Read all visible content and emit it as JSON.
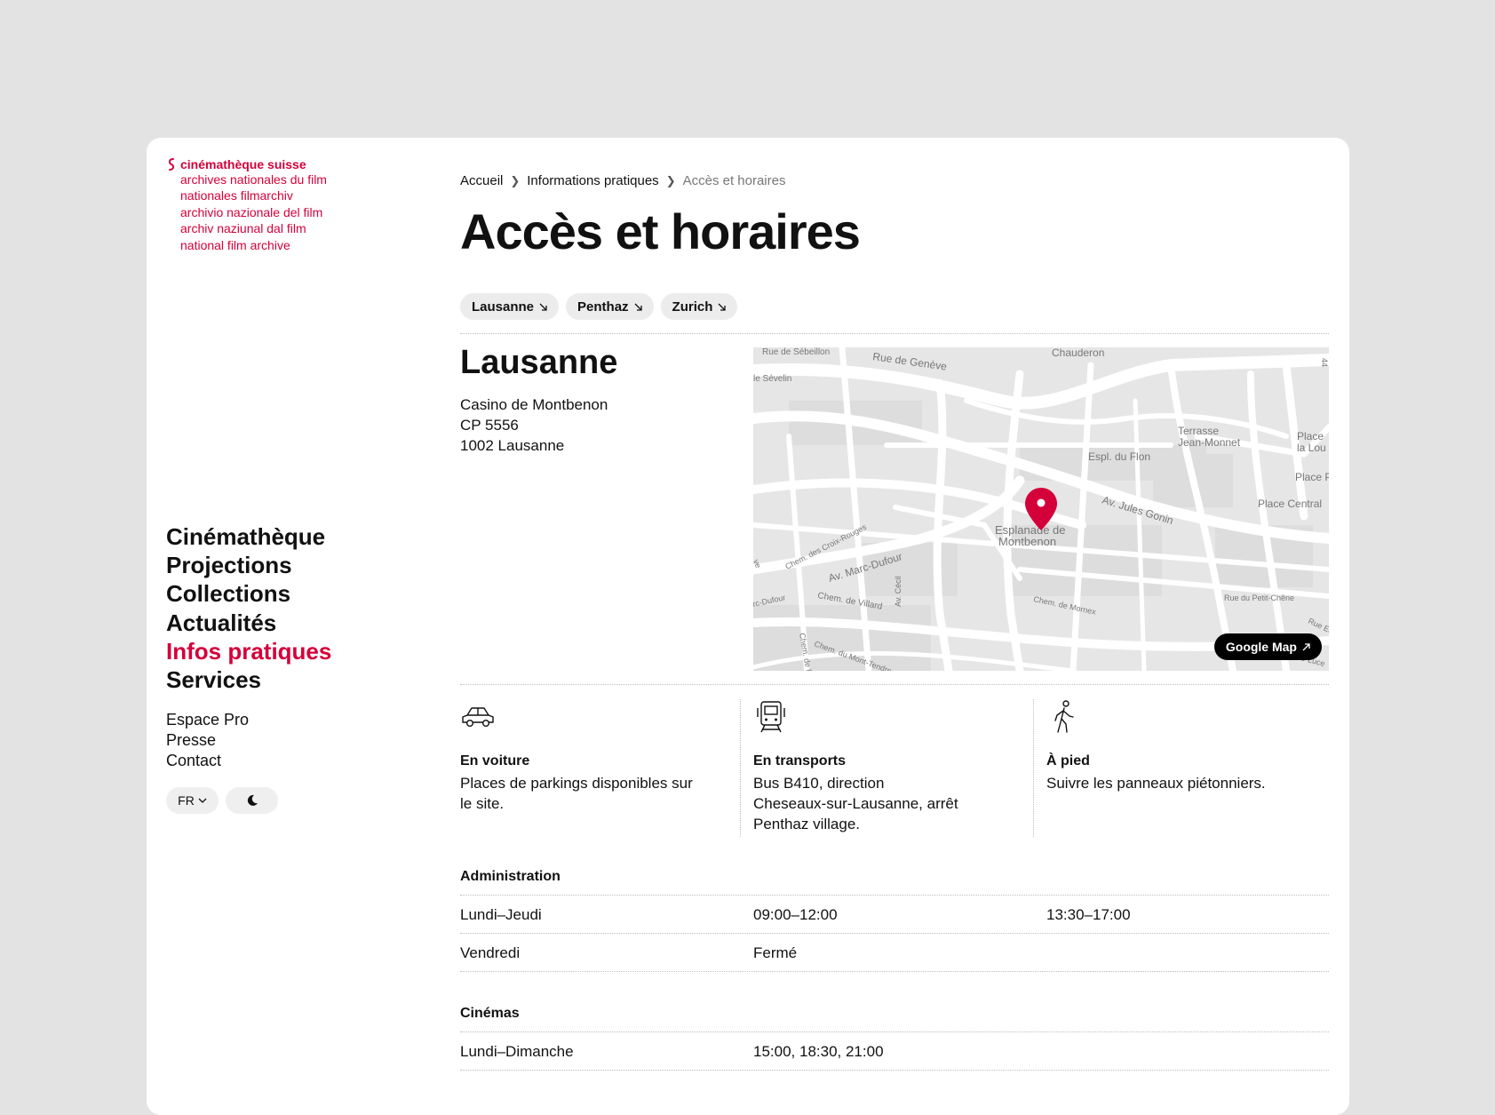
{
  "logo": {
    "main": "cinémathèque suisse",
    "lines": [
      "archives nationales du film",
      "nationales filmarchiv",
      "archivio nazionale del film",
      "archiv naziunal dal film",
      "national film archive"
    ]
  },
  "nav": {
    "items": [
      "Cinémathèque",
      "Projections",
      "Collections",
      "Actualités",
      "Infos pratiques",
      "Services"
    ],
    "active": "Infos pratiques",
    "secondary": [
      "Espace Pro",
      "Presse",
      "Contact"
    ],
    "language": "FR"
  },
  "breadcrumb": [
    "Accueil",
    "Informations pratiques",
    "Accès et horaires"
  ],
  "page_title": "Accès et horaires",
  "location_chips": [
    "Lausanne",
    "Penthaz",
    "Zurich"
  ],
  "location": {
    "name": "Lausanne",
    "address": [
      "Casino de Montbenon",
      "CP 5556",
      "1002 Lausanne"
    ]
  },
  "map": {
    "button": "Google Map",
    "pin_label": [
      "Esplanade de",
      "Montbenon"
    ],
    "labels": {
      "rue_sebeillon": "Rue de Sébeillon",
      "rue_geneve": "Rue de Genève",
      "chauderon": "Chauderon",
      "sevelin": "le Sévelin",
      "terrasse": [
        "Terrasse",
        "Jean-Monnet"
      ],
      "place_lou": [
        "Place",
        "la Lou"
      ],
      "espl_flon": "Espl. du Flon",
      "place_p": "Place P",
      "place_centrale": "Place Central",
      "av_jules_gonin": "Av. Jules Gonin",
      "chem_croix_rouges": "Chem. des Croix-Rouges",
      "av_marc_dufour": "Av. Marc-Dufour",
      "av_cecil": "Av. Cécil",
      "chem_villard": "Chem. de Villard",
      "rc_dufour": "rc-Dufour",
      "chem_mornex": "Chem. de Mornex",
      "rue_petit_chene": "Rue du Petit-Chêne",
      "chem_mont_tendre": "Chem. du Mont-Tendre",
      "chem_fr": "Chem. de Fr",
      "rue_ed": "Rue Ed",
      "luce": "e-Luce",
      "ve": "ve",
      "num_44": "44"
    }
  },
  "access": [
    {
      "title": "En voiture",
      "text": [
        "Places de parkings disponibles sur",
        "le site."
      ],
      "icon": "car-icon"
    },
    {
      "title": "En transports",
      "text": [
        "Bus B410, direction",
        "Cheseaux-sur-Lausanne, arrêt",
        "Penthaz village."
      ],
      "icon": "train-icon"
    },
    {
      "title": "À pied",
      "text": [
        "Suivre les panneaux piétonniers."
      ],
      "icon": "walking-icon"
    }
  ],
  "hours": {
    "administration": {
      "title": "Administration",
      "rows": [
        {
          "day": "Lundi–Jeudi",
          "slot1": "09:00–12:00",
          "slot2": "13:30–17:00"
        },
        {
          "day": "Vendredi",
          "slot1": "Fermé",
          "slot2": ""
        }
      ]
    },
    "cinemas": {
      "title": "Cinémas",
      "rows": [
        {
          "day": "Lundi–Dimanche",
          "slot1": "15:00, 18:30, 21:00",
          "slot2": ""
        }
      ]
    }
  },
  "colors": {
    "accent": "#d4003a",
    "background": "#e3e3e3",
    "card": "#ffffff"
  }
}
